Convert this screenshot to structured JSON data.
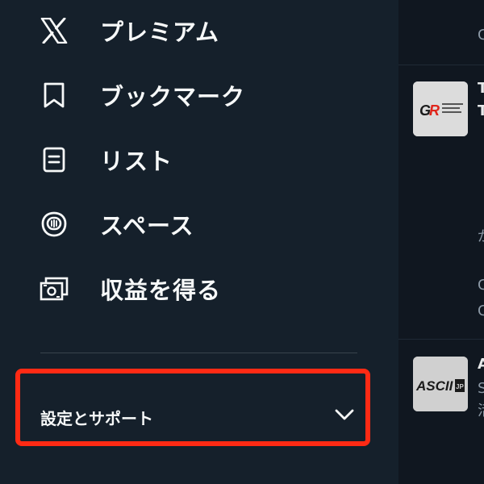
{
  "menu": {
    "items": [
      {
        "label": "プレミアム",
        "icon": "x-logo-icon"
      },
      {
        "label": "ブックマーク",
        "icon": "bookmark-icon"
      },
      {
        "label": "リスト",
        "icon": "list-icon"
      },
      {
        "label": "スペース",
        "icon": "spaces-microphone-icon"
      },
      {
        "label": "収益を得る",
        "icon": "monetization-icon"
      }
    ]
  },
  "settings": {
    "label": "設定とサポート",
    "icon": "chevron-down-icon"
  },
  "timeline": {
    "posts": [
      {
        "avatar_text": "GR TOYOTA GAZOO Racing",
        "line1": "T",
        "line2": "T"
      },
      {
        "avatar_text": "ASCII.jp",
        "line1": "A",
        "line2": "S",
        "line3": "活"
      }
    ]
  },
  "colors": {
    "background": "#15202b",
    "highlight": "#ff2a14",
    "text": "#f7f9f9",
    "divider": "#38444d"
  }
}
